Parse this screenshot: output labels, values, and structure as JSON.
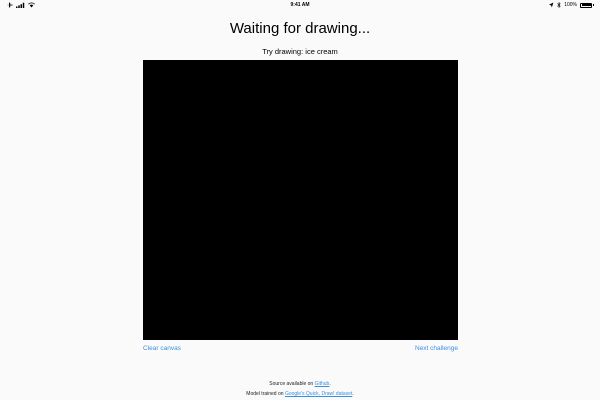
{
  "status_bar": {
    "time": "9:41 AM",
    "battery_percent": "100%",
    "battery_level": 1.0,
    "left_icons": [
      "airplane-icon",
      "signal-icon",
      "wifi-icon"
    ],
    "right_icons": [
      "location-icon",
      "bluetooth-icon"
    ]
  },
  "heading": "Waiting for drawing...",
  "prompt": {
    "prefix": "Try drawing: ",
    "subject": "ice cream"
  },
  "canvas": {
    "color": "#000000"
  },
  "actions": {
    "clear_label": "Clear canvas",
    "next_label": "Next challenge"
  },
  "footer": {
    "line1_prefix": "Source available on ",
    "line1_link": "Github",
    "line1_suffix": ".",
    "line2_prefix": "Model trained on ",
    "line2_link": "Google's Quick, Draw! dataset",
    "line2_suffix": "."
  },
  "colors": {
    "link": "#3b8fe0",
    "background": "#fafafa"
  }
}
